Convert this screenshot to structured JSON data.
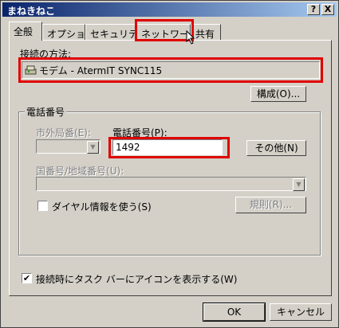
{
  "window": {
    "title": "まねきねこ",
    "help_btn": "?",
    "close_btn": "X"
  },
  "tabs": [
    {
      "label": "全般"
    },
    {
      "label": "オプション"
    },
    {
      "label": "セキュリティ"
    },
    {
      "label": "ネットワーク"
    },
    {
      "label": "共有"
    }
  ],
  "connection": {
    "label": "接続の方法:",
    "device": "モデム - AtermIT SYNC115",
    "config_btn": "構成(O)..."
  },
  "phone": {
    "group_title": "電話番号",
    "area_code_label": "市外局番(E):",
    "area_code_value": "",
    "phone_label": "電話番号(P):",
    "phone_value": "1492",
    "other_btn": "その他(N)",
    "country_label": "国番号/地域番号(U):",
    "country_value": "",
    "use_dialing_label": "ダイヤル情報を使う(S)",
    "use_dialing_checked": "",
    "rules_btn": "規則(R)..."
  },
  "taskbar_icon": {
    "label": "接続時にタスク バーにアイコンを表示する(W)",
    "checked": "✔"
  },
  "footer": {
    "ok": "OK",
    "cancel": "キャンセル"
  }
}
